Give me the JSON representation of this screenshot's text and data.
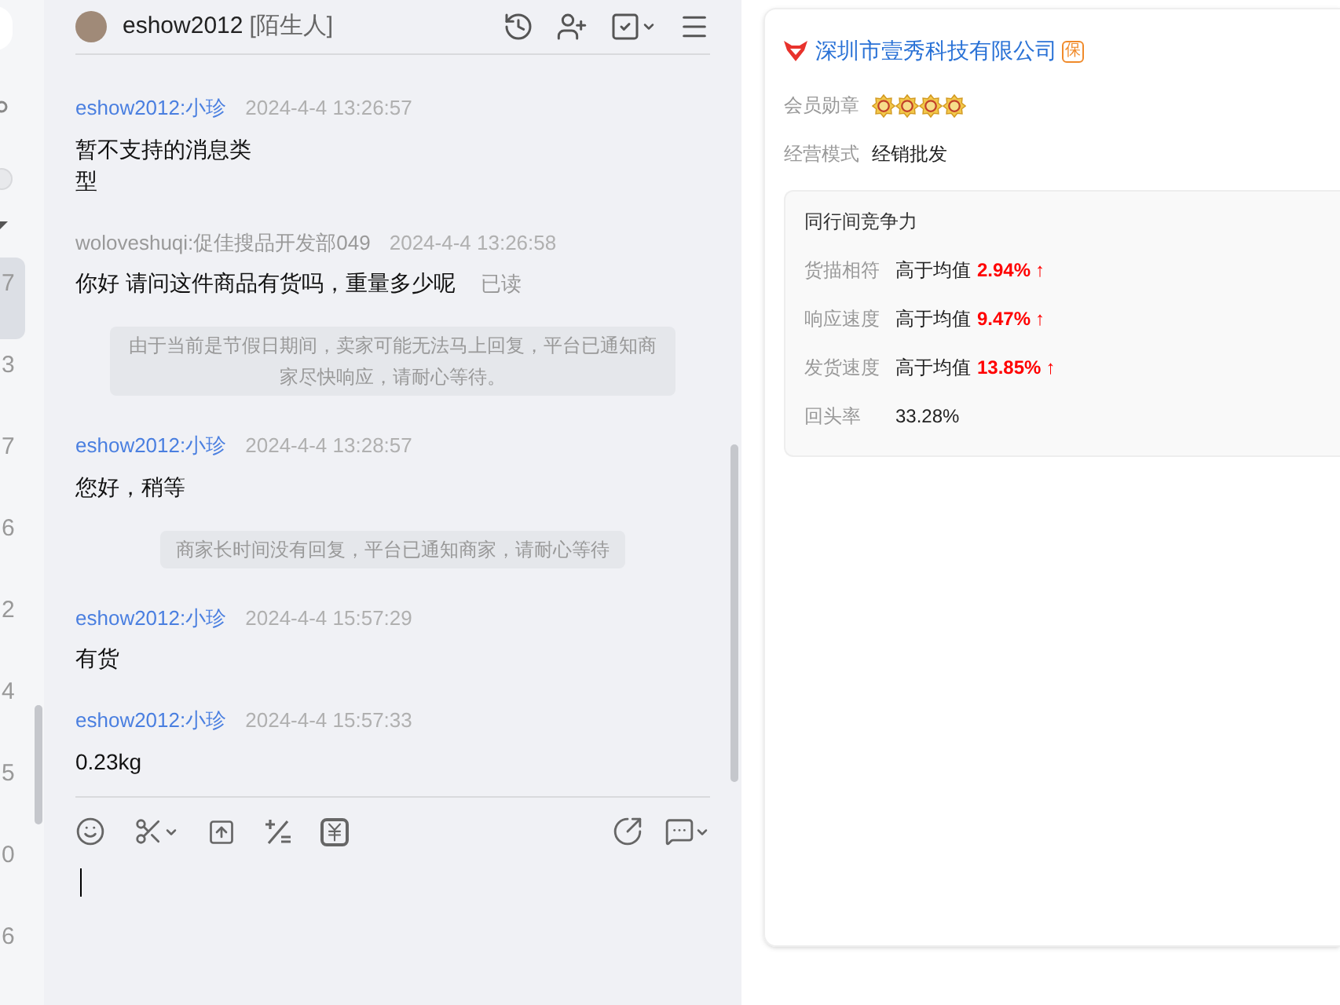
{
  "left_strip": {
    "numbers": [
      {
        "text": "7",
        "selected": true
      },
      {
        "text": "3",
        "selected": false
      },
      {
        "text": "7",
        "selected": false
      },
      {
        "text": "6",
        "selected": false
      },
      {
        "text": "2",
        "selected": false
      },
      {
        "text": "4",
        "selected": false
      },
      {
        "text": "5",
        "selected": false
      },
      {
        "text": "0",
        "selected": false
      },
      {
        "text": "6",
        "selected": false
      }
    ]
  },
  "chat": {
    "contact": "eshow2012",
    "contact_tag": "[陌生人]",
    "messages": [
      {
        "kind": "unsupported",
        "sender": "eshow2012:小珍",
        "time": "2024-4-4 13:26:57",
        "text": "暂不支持的消息类型"
      },
      {
        "kind": "customer",
        "sender": "woloveshuqi:促佳搜品开发部049",
        "time": "2024-4-4 13:26:58",
        "text": "你好 请问这件商品有货吗，重量多少呢",
        "receipt": "已读"
      },
      {
        "kind": "notice",
        "text": "由于当前是节假日期间，卖家可能无法马上回复，平台已通知商家尽快响应，请耐心等待。"
      },
      {
        "kind": "agent",
        "sender": "eshow2012:小珍",
        "time": "2024-4-4 13:28:57",
        "text": "您好，稍等"
      },
      {
        "kind": "notice",
        "text": "商家长时间没有回复，平台已通知商家，请耐心等待"
      },
      {
        "kind": "agent",
        "sender": "eshow2012:小珍",
        "time": "2024-4-4 15:57:29",
        "text": "有货"
      },
      {
        "kind": "agent",
        "sender": "eshow2012:小珍",
        "time": "2024-4-4 15:57:33",
        "text": "0.23kg"
      }
    ]
  },
  "company": {
    "name": "深圳市壹秀科技有限公司",
    "badge": "保",
    "member_badges": {
      "label": "会员勋章",
      "stars": 4
    },
    "business_mode": {
      "label": "经营模式",
      "value": "经销批发"
    },
    "competitiveness": {
      "title": "同行间竞争力",
      "rows": [
        {
          "kind": "compare",
          "label": "货描相符",
          "prefix": "高于均值",
          "value": "2.94%",
          "arrow": "↑"
        },
        {
          "kind": "compare",
          "label": "响应速度",
          "prefix": "高于均值",
          "value": "9.47%",
          "arrow": "↑"
        },
        {
          "kind": "compare",
          "label": "发货速度",
          "prefix": "高于均值",
          "value": "13.85%",
          "arrow": "↑"
        },
        {
          "kind": "plain",
          "label": "回头率",
          "value": "33.28%"
        }
      ]
    }
  }
}
